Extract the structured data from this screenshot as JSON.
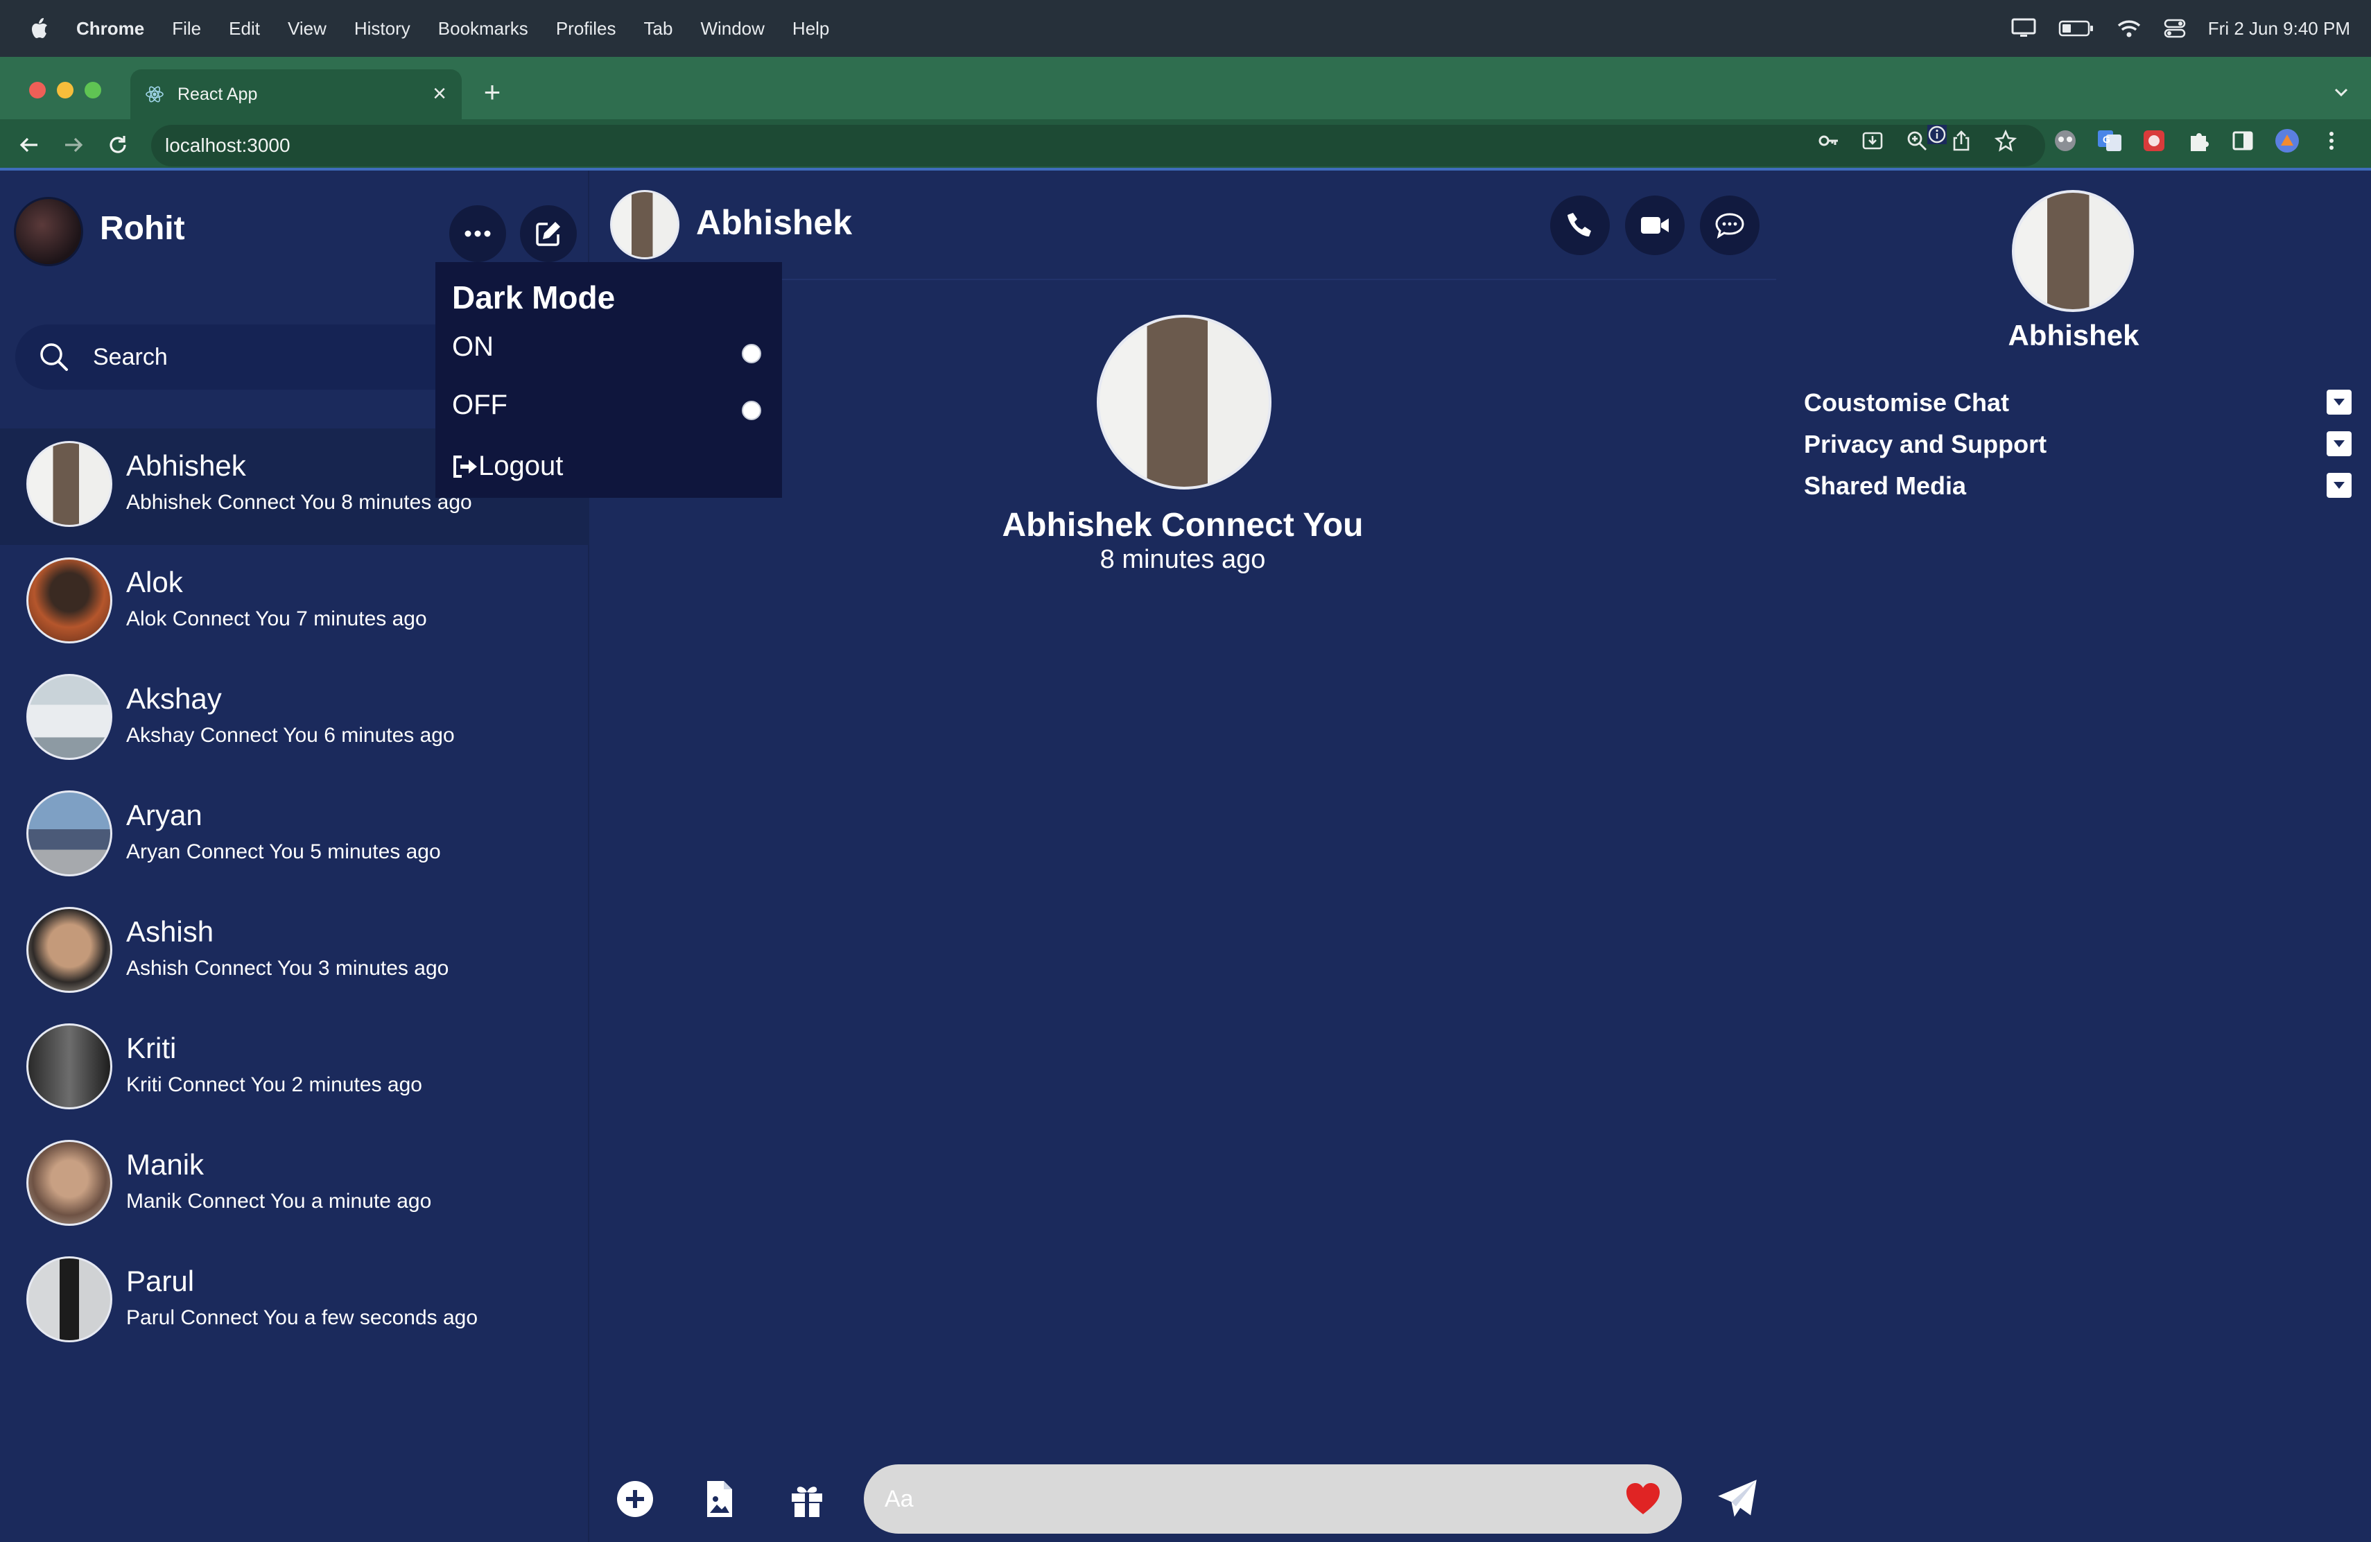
{
  "mac_menubar": {
    "items": [
      "Chrome",
      "File",
      "Edit",
      "View",
      "History",
      "Bookmarks",
      "Profiles",
      "Tab",
      "Window",
      "Help"
    ],
    "clock": "Fri 2 Jun  9:40 PM"
  },
  "browser": {
    "tab_title": "React App",
    "url": "localhost:3000"
  },
  "sidebar": {
    "user_name": "Rohit",
    "search_placeholder": "Search",
    "contacts": [
      {
        "name": "Abhishek",
        "message": "Abhishek Connect You 8 minutes ago"
      },
      {
        "name": "Alok",
        "message": "Alok Connect You 7 minutes ago"
      },
      {
        "name": "Akshay",
        "message": "Akshay Connect You 6 minutes ago"
      },
      {
        "name": "Aryan",
        "message": "Aryan Connect You 5 minutes ago"
      },
      {
        "name": "Ashish",
        "message": "Ashish Connect You 3 minutes ago"
      },
      {
        "name": "Kriti",
        "message": "Kriti Connect You 2 minutes ago"
      },
      {
        "name": "Manik",
        "message": "Manik Connect You a minute ago"
      },
      {
        "name": "Parul",
        "message": "Parul Connect You a few seconds ago"
      }
    ]
  },
  "dropdown": {
    "title": "Dark Mode",
    "on_label": "ON",
    "off_label": "OFF",
    "logout_label": "Logout"
  },
  "chat": {
    "contact_name": "Abhishek",
    "connect_title": "Abhishek Connect You",
    "connect_time": "8 minutes ago",
    "composer_placeholder": "Aa"
  },
  "info_panel": {
    "name": "Abhishek",
    "sections": [
      "Coustomise Chat",
      "Privacy and Support",
      "Shared Media"
    ]
  },
  "colors": {
    "app_background": "#1b2a5c",
    "dark_button": "#111a3f",
    "dropdown_background": "#0f163d",
    "browser_chrome": "#235a3f",
    "heart": "#e02424"
  }
}
